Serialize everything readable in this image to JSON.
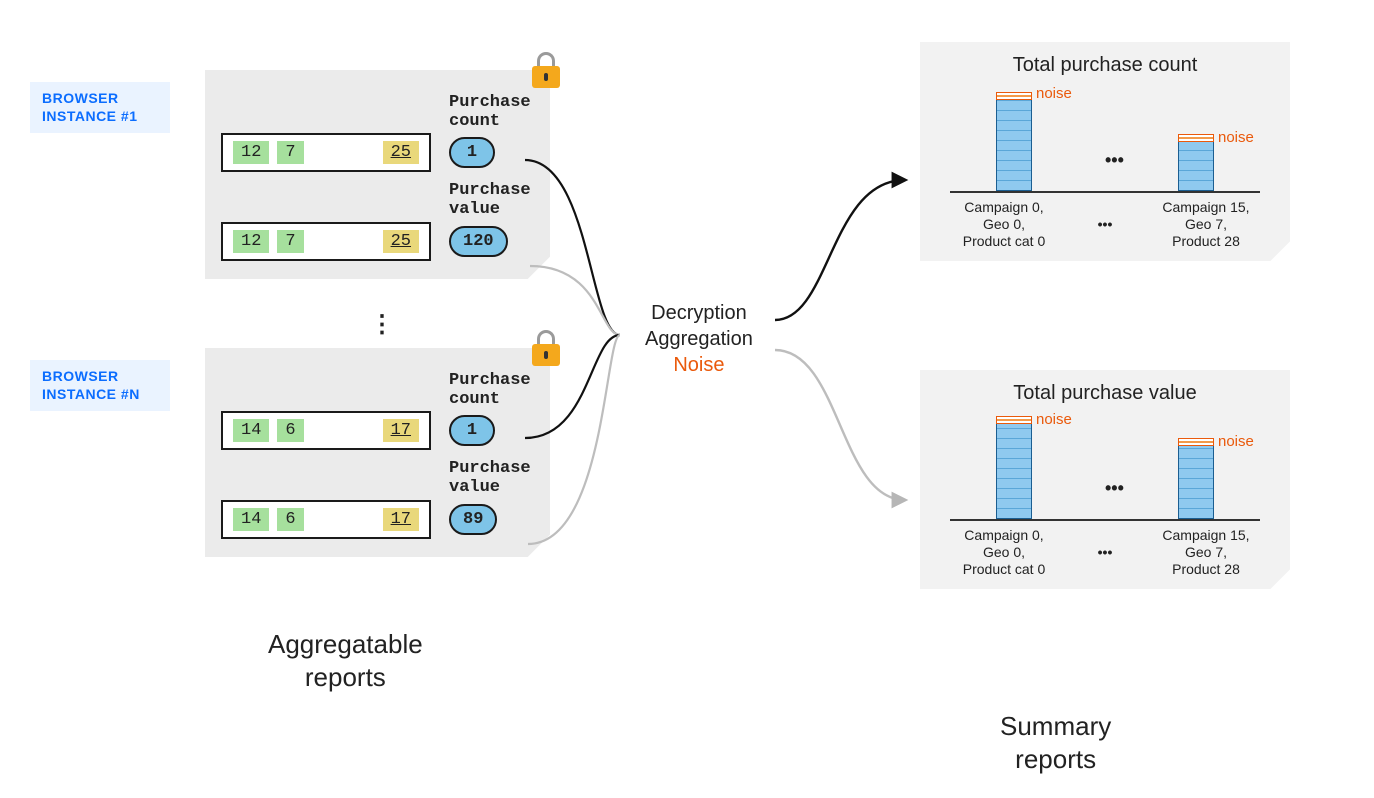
{
  "browser_labels": {
    "b1": "BROWSER INSTANCE #1",
    "bn": "BROWSER INSTANCE #N"
  },
  "cards": {
    "c1": {
      "count_label": "Purchase\ncount",
      "value_label": "Purchase\nvalue",
      "count_value": "1",
      "value_value": "120",
      "keys": [
        "12",
        "7",
        "25"
      ]
    },
    "c2": {
      "count_label": "Purchase\ncount",
      "value_label": "Purchase\nvalue",
      "count_value": "1",
      "value_value": "89",
      "keys": [
        "14",
        "6",
        "17"
      ]
    }
  },
  "vdots": "⋮",
  "process": {
    "line1": "Decryption",
    "line2": "Aggregation",
    "line3": "Noise"
  },
  "captions": {
    "left": "Aggregatable\nreports",
    "right": "Summary\nreports"
  },
  "summary": {
    "s1": {
      "title": "Total purchase count",
      "noise": "noise",
      "hdots": "•••",
      "x1": "Campaign 0,\nGeo 0,\nProduct cat 0",
      "xdots": "•••",
      "x2": "Campaign 15,\nGeo 7,\nProduct 28"
    },
    "s2": {
      "title": "Total purchase value",
      "noise": "noise",
      "hdots": "•••",
      "x1": "Campaign 0,\nGeo 0,\nProduct cat 0",
      "xdots": "•••",
      "x2": "Campaign 15,\nGeo 7,\nProduct 28"
    }
  },
  "chart_data": [
    {
      "type": "bar",
      "title": "Total purchase count",
      "categories": [
        "Campaign 0, Geo 0, Product cat 0",
        "Campaign 15, Geo 7, Product 28"
      ],
      "values_relative": [
        1.0,
        0.55
      ],
      "noise_overlay": true,
      "note": "bars separated by ellipsis; absolute y-axis not shown"
    },
    {
      "type": "bar",
      "title": "Total purchase value",
      "categories": [
        "Campaign 0, Geo 0, Product cat 0",
        "Campaign 15, Geo 7, Product 28"
      ],
      "values_relative": [
        1.0,
        0.75
      ],
      "noise_overlay": true,
      "note": "bars separated by ellipsis; absolute y-axis not shown"
    }
  ]
}
